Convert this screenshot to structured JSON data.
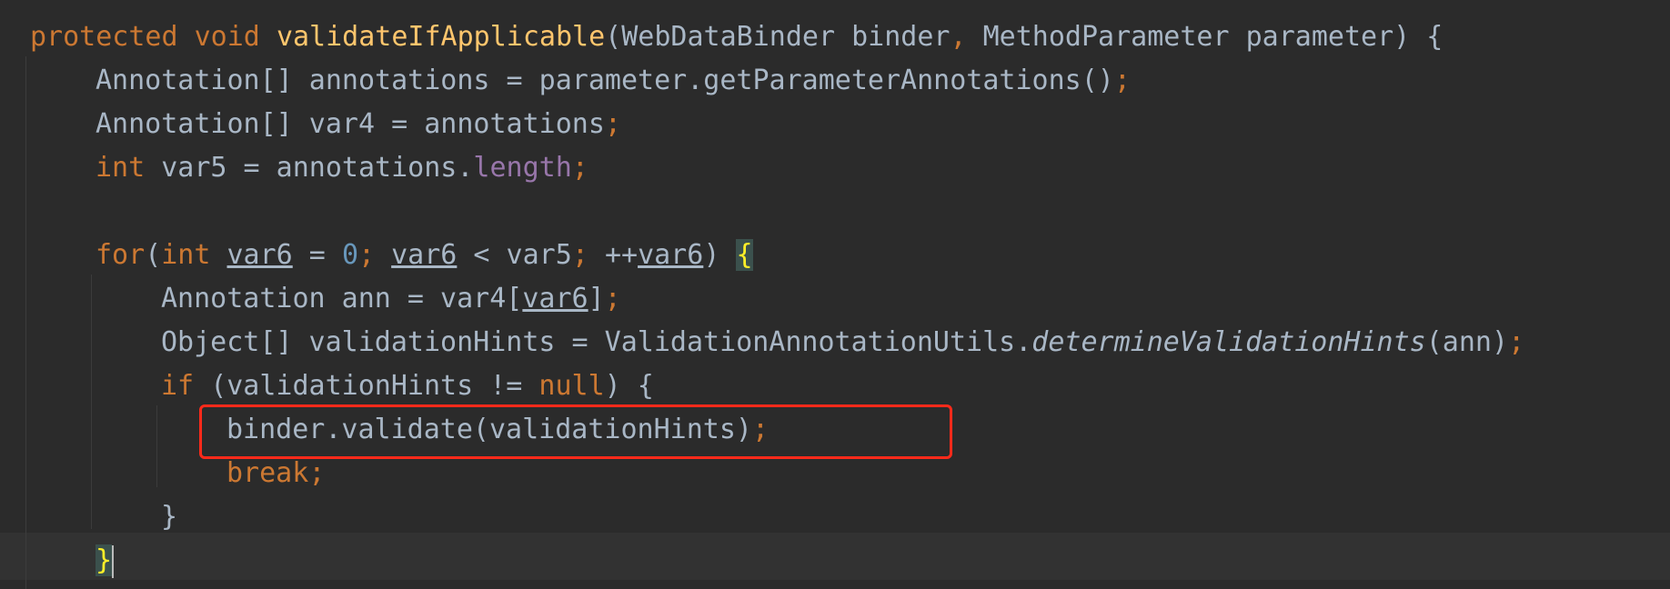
{
  "editor": {
    "colors": {
      "background": "#2b2b2b",
      "keyword": "#cc7832",
      "text": "#a9b7c6",
      "method": "#ffc66d",
      "field": "#9876aa",
      "number": "#6897bb",
      "highlight_box": "#ff2a1a"
    },
    "lines": [
      {
        "indent": 0,
        "tokens": [
          [
            "protected void ",
            "kw"
          ],
          [
            "validateIfApplicable",
            "fn"
          ],
          [
            "(WebDataBinder binder",
            ""
          ],
          [
            ", ",
            "pn"
          ],
          [
            "MethodParameter parameter) {",
            ""
          ]
        ]
      },
      {
        "indent": 1,
        "tokens": [
          [
            "Annotation[] annotations = parameter.getParameterAnnotations()",
            ""
          ],
          [
            ";",
            "pn"
          ]
        ]
      },
      {
        "indent": 1,
        "tokens": [
          [
            "Annotation[] var4 = annotations",
            ""
          ],
          [
            ";",
            "pn"
          ]
        ]
      },
      {
        "indent": 1,
        "tokens": [
          [
            "int ",
            "kw"
          ],
          [
            "var5 = annotations.",
            ""
          ],
          [
            "length",
            "fld"
          ],
          [
            ";",
            "pn"
          ]
        ]
      },
      {
        "indent": 1,
        "tokens": []
      },
      {
        "indent": 1,
        "tokens": [
          [
            "for",
            "kw"
          ],
          [
            "(",
            ""
          ],
          [
            "int ",
            "kw"
          ],
          [
            "var6",
            "ul"
          ],
          [
            " = ",
            ""
          ],
          [
            "0",
            "num"
          ],
          [
            "; ",
            "pn"
          ],
          [
            "var6",
            "ul"
          ],
          [
            " < var5",
            ""
          ],
          [
            "; ",
            "pn"
          ],
          [
            "++",
            ""
          ],
          [
            "var6",
            "ul"
          ],
          [
            ") ",
            ""
          ],
          [
            "{",
            "br"
          ]
        ]
      },
      {
        "indent": 2,
        "tokens": [
          [
            "Annotation ann = var4[",
            ""
          ],
          [
            "var6",
            "ul"
          ],
          [
            "]",
            ""
          ],
          [
            ";",
            "pn"
          ]
        ]
      },
      {
        "indent": 2,
        "tokens": [
          [
            "Object[] validationHints = ValidationAnnotationUtils.",
            ""
          ],
          [
            "determineValidationHints",
            "it"
          ],
          [
            "(ann)",
            ""
          ],
          [
            ";",
            "pn"
          ]
        ]
      },
      {
        "indent": 2,
        "tokens": [
          [
            "if ",
            "kw"
          ],
          [
            "(validationHints != ",
            ""
          ],
          [
            "null",
            "kw"
          ],
          [
            ") {",
            ""
          ]
        ]
      },
      {
        "indent": 3,
        "tokens": [
          [
            "binder.validate(validationHints)",
            ""
          ],
          [
            ";",
            "pn"
          ]
        ]
      },
      {
        "indent": 3,
        "tokens": [
          [
            "break",
            "kw"
          ],
          [
            ";",
            "pn"
          ]
        ]
      },
      {
        "indent": 2,
        "tokens": [
          [
            "}",
            ""
          ]
        ]
      },
      {
        "indent": 1,
        "tokens": [
          [
            "}",
            "br"
          ]
        ],
        "caret": true
      }
    ]
  }
}
